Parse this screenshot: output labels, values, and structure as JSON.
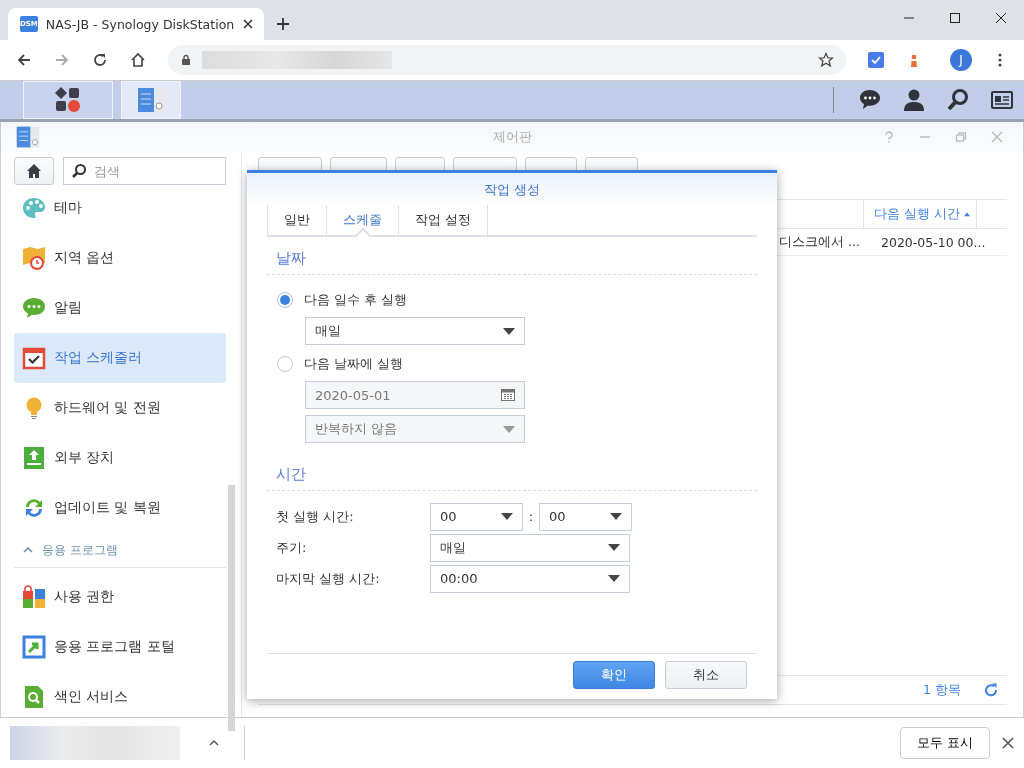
{
  "browser": {
    "tab_title": "NAS-JB - Synology DiskStation",
    "favicon_text": "DSM",
    "profile": "J"
  },
  "taskbar": {
    "apps": [
      {
        "selected": false
      },
      {
        "selected": true
      }
    ]
  },
  "window": {
    "title": "제어판"
  },
  "sidebar": {
    "search_placeholder": "검색",
    "items": [
      {
        "kind": "item",
        "label": "테마",
        "selected": false
      },
      {
        "kind": "item",
        "label": "지역 옵션",
        "selected": false
      },
      {
        "kind": "item",
        "label": "알림",
        "selected": false
      },
      {
        "kind": "item",
        "label": "작업 스케줄러",
        "selected": true
      },
      {
        "kind": "item",
        "label": "하드웨어 및 전원",
        "selected": false
      },
      {
        "kind": "item",
        "label": "외부 장치",
        "selected": false
      },
      {
        "kind": "item",
        "label": "업데이트 및 복원",
        "selected": false
      },
      {
        "kind": "section",
        "label": "응용 프로그램",
        "expanded": true
      },
      {
        "kind": "item",
        "label": "사용 권한",
        "selected": false
      },
      {
        "kind": "item",
        "label": "응용 프로그램 포털",
        "selected": false
      },
      {
        "kind": "item",
        "label": "색인 서비스",
        "selected": false
      }
    ]
  },
  "table": {
    "columns": [
      {
        "sorted": false
      },
      {
        "label": "다음 실행 시간",
        "sorted": true
      }
    ],
    "rows": [
      {
        "cells": [
          "디스크에서 ...",
          "2020-05-10 00..."
        ]
      }
    ],
    "footer_count": "1 항목"
  },
  "dialog": {
    "title": "작업 생성",
    "tabs": [
      {
        "label": "일반",
        "selected": false
      },
      {
        "label": "스케줄",
        "selected": true
      },
      {
        "label": "작업 설정",
        "selected": false
      }
    ],
    "date_section": {
      "title": "날짜",
      "options": [
        {
          "label": "다음 일수 후 실행",
          "selected": true,
          "fields": [
            {
              "kind": "select",
              "value": "매일",
              "disabled": false
            }
          ]
        },
        {
          "label": "다음 날짜에 실행",
          "selected": false,
          "fields": [
            {
              "kind": "date",
              "value": "2020-05-01",
              "disabled": true
            },
            {
              "kind": "select",
              "value": "반복하지 않음",
              "disabled": true
            }
          ]
        }
      ]
    },
    "time_section": {
      "title": "시간",
      "rows": [
        {
          "label": "첫 실행 시간:",
          "separator": ":",
          "fields": [
            {
              "kind": "select",
              "value": "00",
              "disabled": false
            },
            {
              "kind": "select",
              "value": "00",
              "disabled": false
            }
          ]
        },
        {
          "label": "주기:",
          "fields": [
            {
              "kind": "select",
              "value": "매일",
              "disabled": false
            }
          ]
        },
        {
          "label": "마지막 실행 시간:",
          "fields": [
            {
              "kind": "select",
              "value": "00:00",
              "disabled": false
            }
          ]
        }
      ]
    },
    "buttons": [
      {
        "label": "확인",
        "kind": "primary"
      },
      {
        "label": "취소",
        "kind": "secondary"
      }
    ]
  },
  "download_bar": {
    "show_all": "모두 표시"
  }
}
